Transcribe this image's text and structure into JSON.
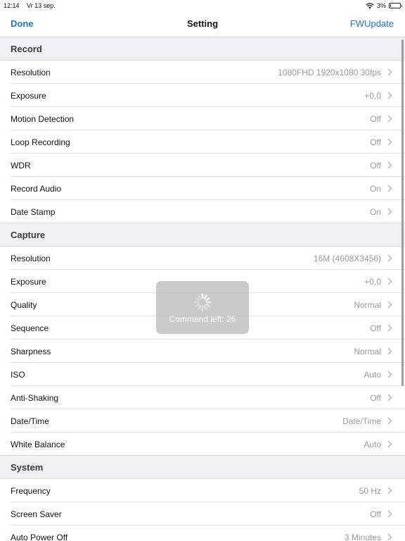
{
  "status_bar": {
    "time": "12:14",
    "date": "Vr 13 sep.",
    "battery": "3%",
    "icons": [
      "wifi-icon",
      "battery-icon"
    ]
  },
  "nav": {
    "left_label": "Done",
    "title": "Setting",
    "right_label": "FWUpdate",
    "accent_color": "#1a73d9"
  },
  "sections": [
    {
      "header": "Record",
      "rows": [
        {
          "label": "Resolution",
          "value": "1080FHD 1920x1080 30fps"
        },
        {
          "label": "Exposure",
          "value": "+0.0"
        },
        {
          "label": "Motion Detection",
          "value": "Off"
        },
        {
          "label": "Loop Recording",
          "value": "Off"
        },
        {
          "label": "WDR",
          "value": "Off"
        },
        {
          "label": "Record Audio",
          "value": "On"
        },
        {
          "label": "Date Stamp",
          "value": "On"
        }
      ]
    },
    {
      "header": "Capture",
      "rows": [
        {
          "label": "Resolution",
          "value": "16M (4608X3456)"
        },
        {
          "label": "Exposure",
          "value": "+0.0"
        },
        {
          "label": "Quality",
          "value": "Normal"
        },
        {
          "label": "Sequence",
          "value": "Off"
        },
        {
          "label": "Sharpness",
          "value": "Normal"
        },
        {
          "label": "ISO",
          "value": "Auto"
        },
        {
          "label": "Anti-Shaking",
          "value": "Off"
        },
        {
          "label": "Date/Time",
          "value": "Date/Time"
        },
        {
          "label": "White Balance",
          "value": "Auto"
        }
      ]
    },
    {
      "header": "System",
      "rows": [
        {
          "label": "Frequency",
          "value": "50 Hz"
        },
        {
          "label": "Screen Saver",
          "value": "Off"
        },
        {
          "label": "Auto Power Off",
          "value": "3 Minutes"
        }
      ]
    }
  ],
  "hud": {
    "text": "Command left: 26",
    "icon": "spinner-icon"
  }
}
